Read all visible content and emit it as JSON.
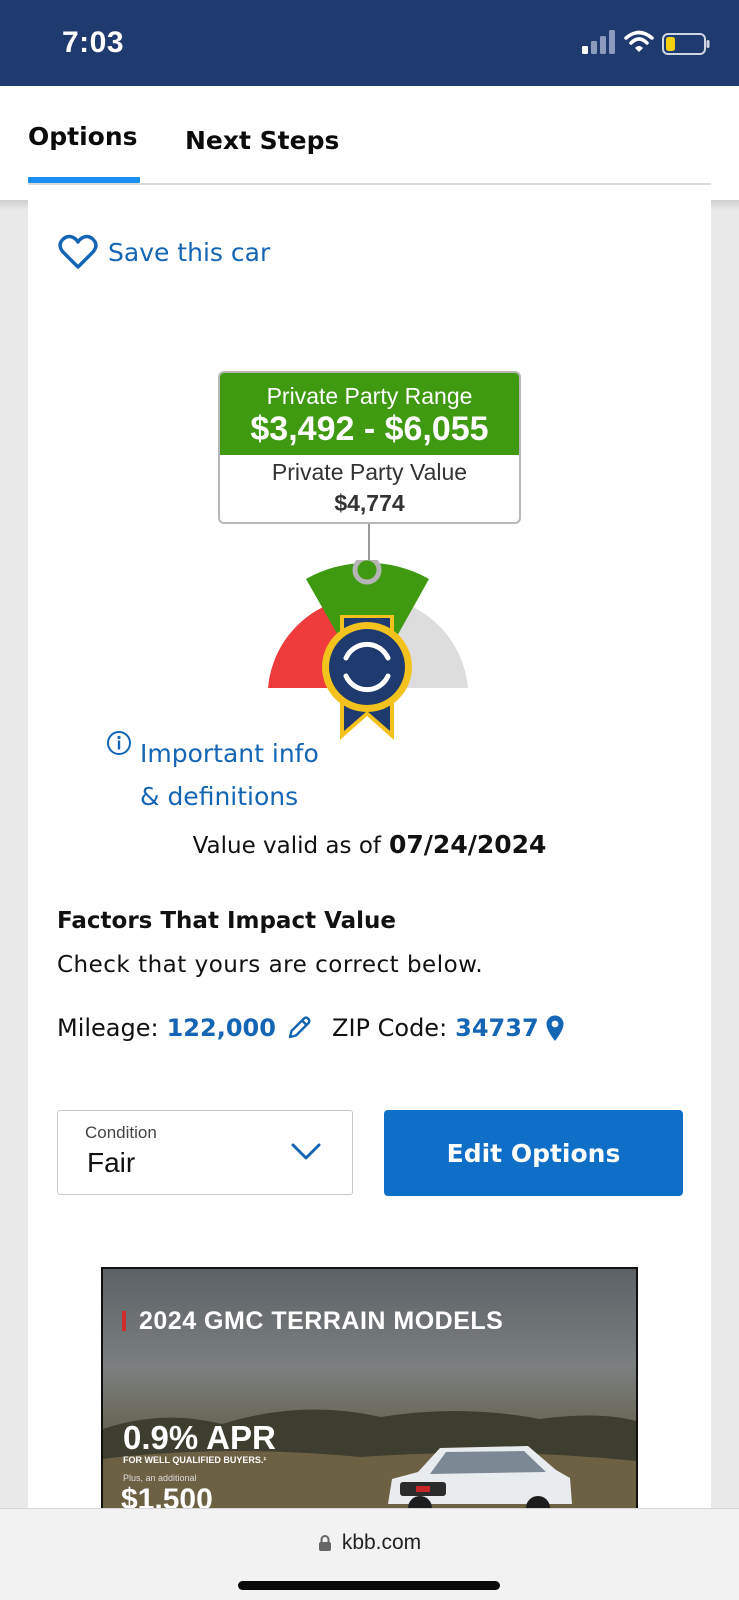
{
  "status_bar": {
    "time": "7:03",
    "signal_icon": "cellular-signal-icon",
    "wifi_icon": "wifi-icon",
    "battery_icon": "battery-low-icon",
    "battery_level": 0.2
  },
  "tabs": [
    {
      "label": "Options",
      "active": true
    },
    {
      "label": "Next Steps",
      "active": false
    }
  ],
  "save": {
    "label": "Save this car",
    "icon": "heart-outline-icon"
  },
  "valuation": {
    "range_title": "Private Party Range",
    "range_amount": "$3,492 - $6,055",
    "value_label": "Private Party Value",
    "value_amount": "$4,774",
    "gauge_icon": "kbb-ribbon-badge-icon",
    "colors": {
      "range_green": "#3f9a12",
      "low_red": "#ef3b3b",
      "high_gray": "#dddddd",
      "badge_navy": "#1f3a6e",
      "badge_gold": "#f3c21c"
    }
  },
  "info": {
    "label": "Important info & definitions",
    "icon": "info-circle-icon"
  },
  "valid": {
    "prefix": "Value valid as of",
    "date": "07/24/2024"
  },
  "factors": {
    "title": "Factors That Impact Value",
    "subtitle": "Check that yours are correct below.",
    "mileage_label": "Mileage:",
    "mileage_value": "122,000",
    "mileage_icon": "pencil-icon",
    "zip_label": "ZIP Code:",
    "zip_value": "34737",
    "zip_icon": "map-pin-icon"
  },
  "condition": {
    "label": "Condition",
    "value": "Fair",
    "icon": "chevron-down-icon"
  },
  "edit_button": {
    "label": "Edit Options"
  },
  "ad": {
    "title": "2024 GMC TERRAIN MODELS",
    "apr": "0.9% APR",
    "qualifier": "FOR WELL QUALIFIED BUYERS.¹",
    "plus": "Plus, an additional",
    "amount": "$1,500"
  },
  "browser": {
    "url": "kbb.com",
    "lock_icon": "lock-icon"
  },
  "colors": {
    "accent_blue": "#1565b5",
    "button_blue": "#0f6fc6",
    "header_navy": "#1f3a6e",
    "tab_underline": "#1a8ef1"
  }
}
